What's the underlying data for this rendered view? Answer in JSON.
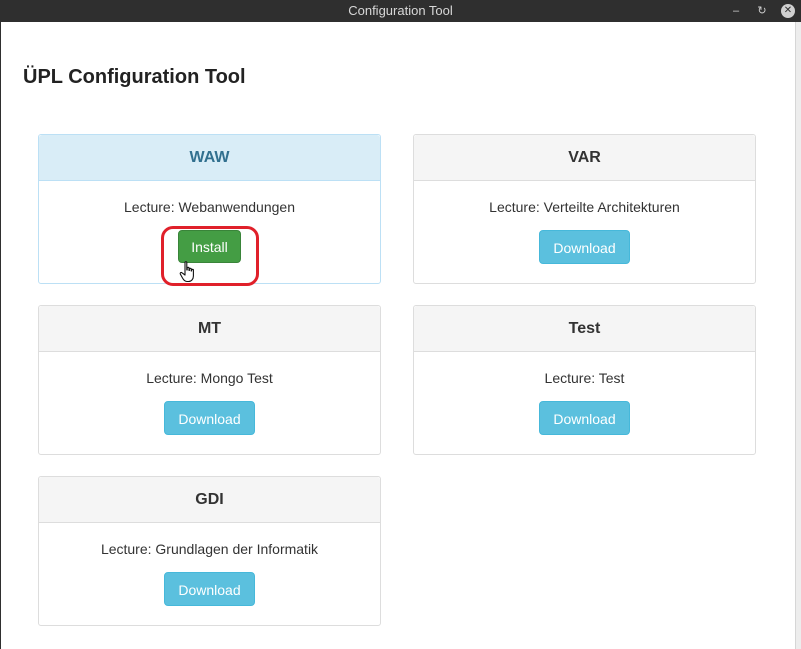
{
  "window": {
    "title": "Configuration Tool",
    "minimize_glyph": "–",
    "maximize_glyph": "↻",
    "close_glyph": "✕"
  },
  "page": {
    "title": "ÜPL Configuration Tool"
  },
  "cards": [
    {
      "code": "WAW",
      "lecture": "Lecture: Webanwendungen",
      "button": "Install",
      "button_type": "install",
      "highlighted": true
    },
    {
      "code": "VAR",
      "lecture": "Lecture: Verteilte Architekturen",
      "button": "Download",
      "button_type": "download",
      "highlighted": false
    },
    {
      "code": "MT",
      "lecture": "Lecture: Mongo Test",
      "button": "Download",
      "button_type": "download",
      "highlighted": false
    },
    {
      "code": "Test",
      "lecture": "Lecture: Test",
      "button": "Download",
      "button_type": "download",
      "highlighted": false
    },
    {
      "code": "GDI",
      "lecture": "Lecture: Grundlagen der Informatik",
      "button": "Download",
      "button_type": "download",
      "highlighted": false
    }
  ],
  "colors": {
    "install": "#449d44",
    "download": "#5bc0de",
    "active_header": "#d9edf7",
    "highlight_ring": "#e0202a"
  },
  "icons": {
    "cursor": "hand-pointer-icon"
  }
}
